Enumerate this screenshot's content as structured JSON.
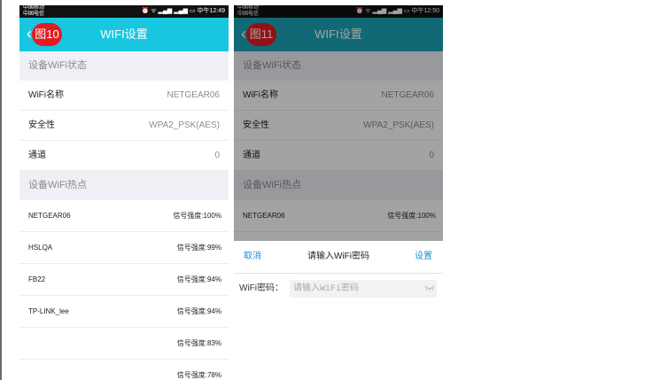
{
  "screen1": {
    "status": {
      "carrier_line1": "中国移动",
      "carrier_line2": "中国电信",
      "icons": "alarm-wifi-signal-battery-icons",
      "time": "中午12:49"
    },
    "badge": "图10",
    "title": "WIFI设置",
    "section_status": "设备WiFi状态",
    "rows": [
      {
        "label": "WiFi名称",
        "value": "NETGEAR06"
      },
      {
        "label": "安全性",
        "value": "WPA2_PSK(AES)"
      },
      {
        "label": "通道",
        "value": "0"
      }
    ],
    "section_hotspots": "设备WiFi热点",
    "hotspots": [
      {
        "name": "NETGEAR06",
        "signal": "信号强度:100%"
      },
      {
        "name": "HSLQA",
        "signal": "信号强度:99%"
      },
      {
        "name": "FB22",
        "signal": "信号强度:94%"
      },
      {
        "name": "TP-LINK_lee",
        "signal": "信号强度:94%"
      },
      {
        "name": "",
        "signal": "信号强度:83%"
      },
      {
        "name": "",
        "signal": "信号强度:78%"
      }
    ]
  },
  "screen2": {
    "status": {
      "carrier_line1": "中国移动",
      "carrier_line2": "中国电信",
      "time": "中午12:50"
    },
    "badge": "图11",
    "title": "WIFI设置",
    "section_status": "设备WiFi状态",
    "rows": [
      {
        "label": "WiFi名称",
        "value": "NETGEAR06"
      },
      {
        "label": "安全性",
        "value": "WPA2_PSK(AES)"
      },
      {
        "label": "通道",
        "value": "0"
      }
    ],
    "section_hotspots": "设备WiFi热点",
    "hotspots": [
      {
        "name": "NETGEAR06",
        "signal": "信号强度:100%"
      }
    ],
    "dialog": {
      "cancel": "取消",
      "title": "请输入WiFi密码",
      "confirm": "设置",
      "password_label": "WiFi密码：",
      "password_placeholder": "请输入WiFi密码",
      "password_value": "",
      "eye_icon": "eye-closed-icon"
    }
  },
  "colors": {
    "titlebar1": "#18c6e0",
    "titlebar2": "#1aa5b8",
    "badge": "#e31b23",
    "link": "#1f8fd6"
  }
}
